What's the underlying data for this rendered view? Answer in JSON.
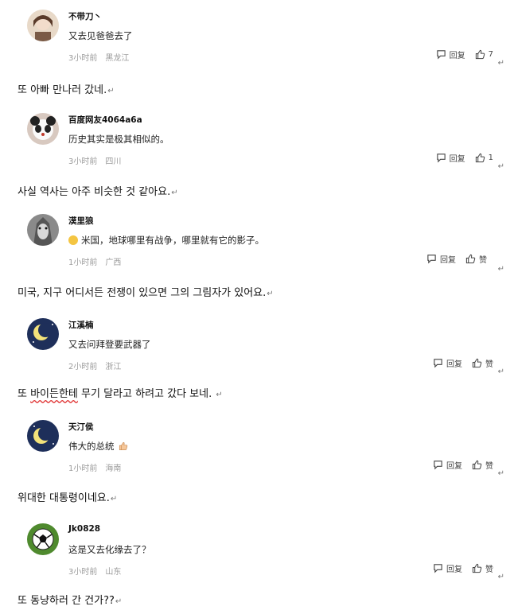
{
  "ui": {
    "reply_label": "回复",
    "like_label": "赞"
  },
  "comments": [
    {
      "username": "不带刀丶",
      "text": "又去见爸爸去了",
      "time": "3小时前",
      "location": "黑龙江",
      "likes": "7",
      "translation": "또 아빠 만나러 갔네."
    },
    {
      "username": "百度网友4064a6a",
      "text": "历史其实是极其相似的。",
      "time": "3小时前",
      "location": "四川",
      "likes": "1",
      "translation": "사실 역사는 아주 비슷한 것 같아요."
    },
    {
      "username": "漠里狼",
      "text": "米国，地球哪里有战争，哪里就有它的影子。",
      "time": "1小时前",
      "location": "广西",
      "likes": "赞",
      "translation": "미국, 지구 어디서든 전쟁이 있으면 그의 그림자가 있어요."
    },
    {
      "username": "江溪楠",
      "text": "又去问拜登要武器了",
      "time": "2小时前",
      "location": "浙江",
      "likes": "赞",
      "translation_a": "또 ",
      "translation_b": "바이든한테",
      "translation_c": " 무기 달라고 하려고 갔다 보네. "
    },
    {
      "username": "天汀侯",
      "text": "伟大的总统",
      "time": "1小时前",
      "location": "海南",
      "likes": "赞",
      "translation": "위대한 대통령이네요."
    },
    {
      "username": "Jk0828",
      "text": "这是又去化缘去了？",
      "time": "3小时前",
      "location": "山东",
      "likes": "赞",
      "translation": "또 동냥하러 간 건가??"
    }
  ],
  "icons": {
    "reply": "comment-bubble-icon",
    "like": "thumbs-up-icon"
  },
  "colors": {
    "meta": "#9a9a9a",
    "spellcheck": "#e03030"
  }
}
